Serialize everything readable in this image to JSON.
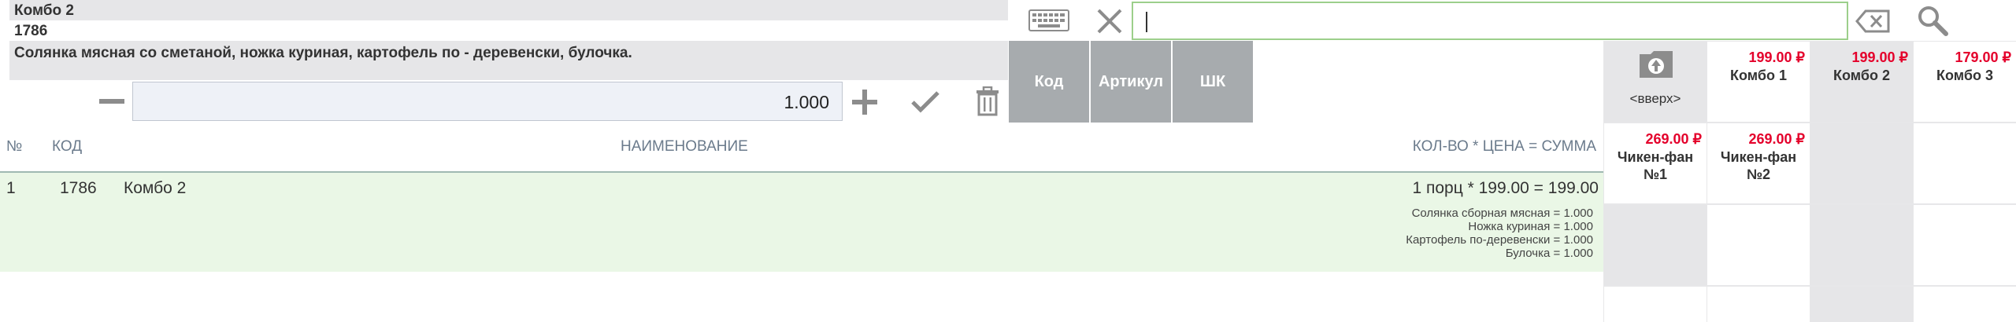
{
  "selected_item": {
    "name": "Комбо 2",
    "code": "1786",
    "description": "Солянка мясная со сметаной, ножка куриная, картофель по - деревенски, булочка.",
    "quantity": "1.000"
  },
  "table": {
    "headers": {
      "num": "№",
      "code": "КОД",
      "name": "НАИМЕНОВАНИЕ",
      "qty_price_sum": "КОЛ-ВО * ЦЕНА = СУММА"
    },
    "rows": [
      {
        "num": "1",
        "code": "1786",
        "name": "Комбо 2",
        "total": "1 порц * 199.00 = 199.00",
        "components": [
          "Солянка сборная мясная = 1.000",
          "Ножка куриная = 1.000",
          "Картофель по-деревенски = 1.000",
          "Булочка = 1.000"
        ]
      }
    ]
  },
  "search": {
    "value": "",
    "tabs": [
      "Код",
      "Артикул",
      "ШК"
    ]
  },
  "grid": {
    "up_label": "<вверх>",
    "products": [
      {
        "name": "Комбо 1",
        "price": "199.00 ₽"
      },
      {
        "name": "Комбо 2",
        "price": "199.00 ₽"
      },
      {
        "name": "Комбо 3",
        "price": "179.00 ₽"
      },
      {
        "name": "Чикен-фан №1",
        "price": "269.00 ₽"
      },
      {
        "name": "Чикен-фан №2",
        "price": "269.00 ₽"
      }
    ]
  },
  "colors": {
    "accent_green": "#9ccf8b",
    "price_red": "#e4002b",
    "row_highlight": "#eaf7e6",
    "tab_gray": "#a7abae"
  }
}
